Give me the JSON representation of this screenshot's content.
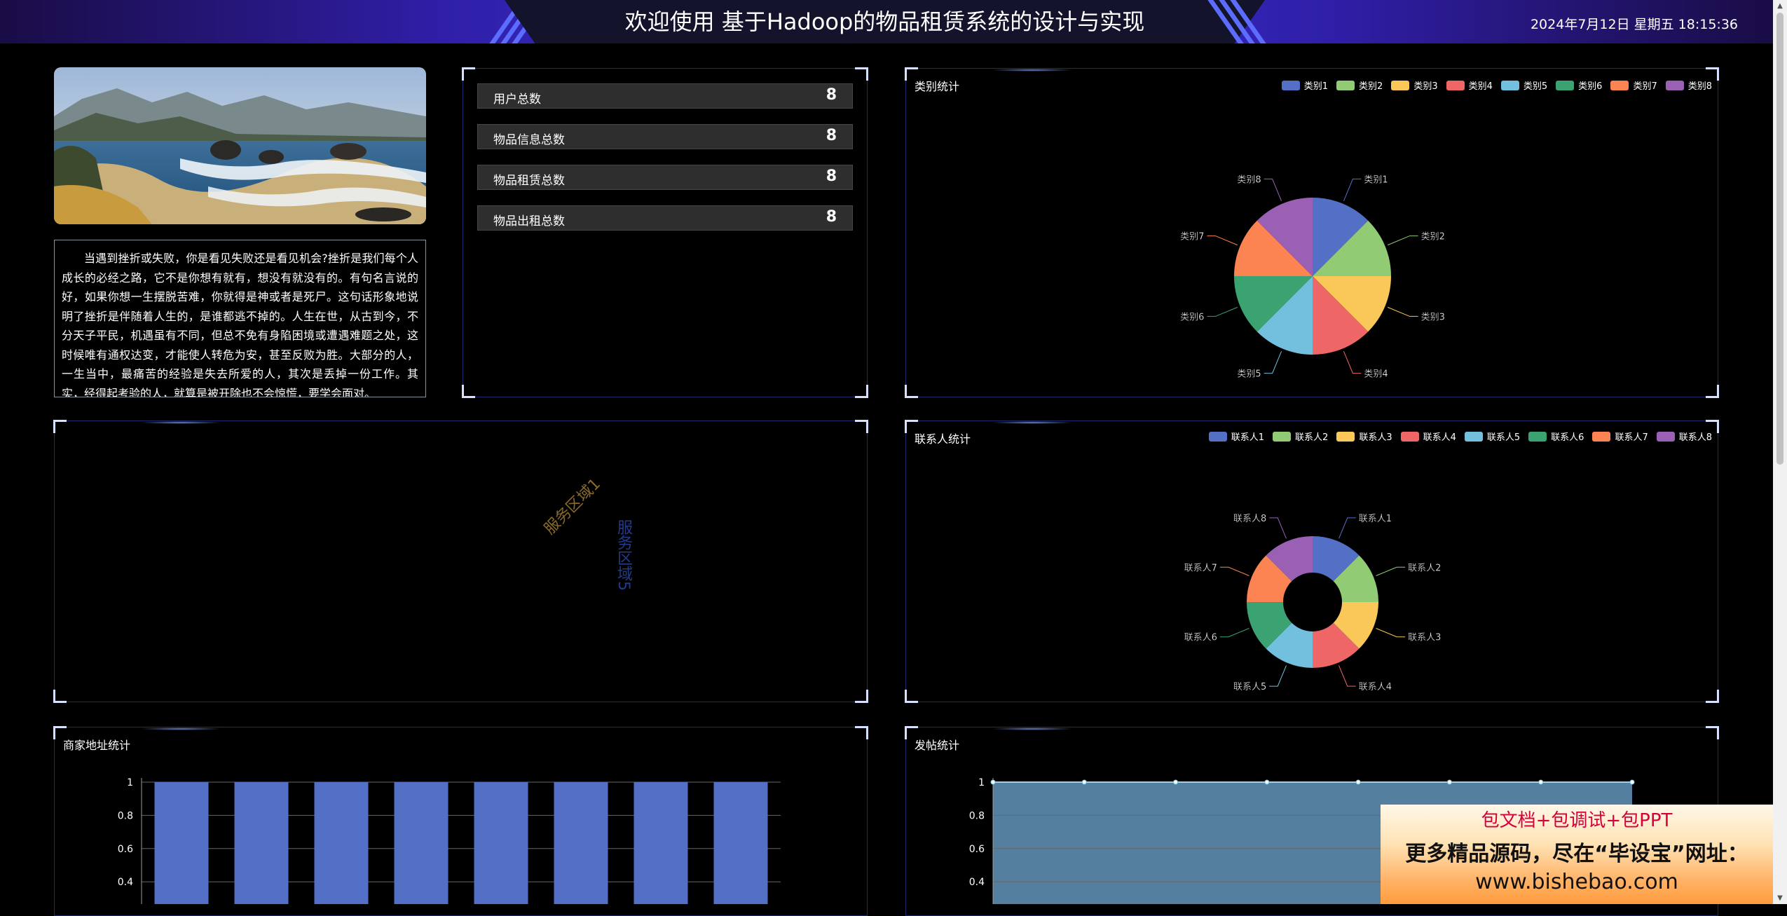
{
  "header": {
    "title": "欢迎使用 基于Hadoop的物品租赁系统的设计与实现",
    "datetime": "2024年7月12日 星期五 18:15:36"
  },
  "article": {
    "text": "当遇到挫折或失败，你是看见失败还是看见机会?挫折是我们每个人成长的必经之路，它不是你想有就有，想没有就没有的。有句名言说的好，如果你想一生摆脱苦难，你就得是神或者是死尸。这句话形象地说明了挫折是伴随着人生的，是谁都逃不掉的。人生在世，从古到今，不分天子平民，机遇虽有不同，但总不免有身陷困境或遭遇难题之处，这时候唯有通权达变，才能使人转危为安，甚至反败为胜。大部分的人，一生当中，最痛苦的经验是失去所爱的人，其次是丢掉一份工作。其实，经得起考验的人，就算是被开除也不会惊慌，要学会面对。"
  },
  "stats": [
    {
      "label": "用户总数",
      "value": "8"
    },
    {
      "label": "物品信息总数",
      "value": "8"
    },
    {
      "label": "物品租赁总数",
      "value": "8"
    },
    {
      "label": "物品出租总数",
      "value": "8"
    }
  ],
  "colors": {
    "palette": [
      "#5470c6",
      "#91cc75",
      "#fac858",
      "#ee6666",
      "#73c0de",
      "#3ba272",
      "#fc8452",
      "#9a60b4"
    ],
    "panel_border": "#1d2b6a",
    "header_accent": "#3a33d6"
  },
  "icons": {
    "scroll_up": "▲",
    "scroll_down": "▼"
  },
  "region_panel": {
    "labels": [
      "服务区域1",
      "服务区域5"
    ]
  },
  "chart_data": [
    {
      "id": "category",
      "type": "pie",
      "title": "类别统计",
      "categories": [
        "类别1",
        "类别2",
        "类别3",
        "类别4",
        "类别5",
        "类别6",
        "类别7",
        "类别8"
      ],
      "values": [
        1,
        1,
        1,
        1,
        1,
        1,
        1,
        1
      ],
      "legend": "top-right"
    },
    {
      "id": "contact",
      "type": "pie",
      "title": "联系人统计",
      "categories": [
        "联系人1",
        "联系人2",
        "联系人3",
        "联系人4",
        "联系人5",
        "联系人6",
        "联系人7",
        "联系人8"
      ],
      "values": [
        1,
        1,
        1,
        1,
        1,
        1,
        1,
        1
      ],
      "donut": true,
      "legend": "top-right"
    },
    {
      "id": "merchant",
      "type": "bar",
      "title": "商家地址统计",
      "categories": [
        "",
        "",
        "",
        "",
        "",
        "",
        "",
        ""
      ],
      "values": [
        1,
        1,
        1,
        1,
        1,
        1,
        1,
        1
      ],
      "yticks": [
        "1",
        "0.8",
        "0.6",
        "0.4"
      ],
      "ylim": [
        0,
        1
      ],
      "grid": true
    },
    {
      "id": "posts",
      "type": "area",
      "title": "发帖统计",
      "categories": [
        "",
        "",
        "",
        "",
        "",
        "",
        "",
        ""
      ],
      "values": [
        1,
        1,
        1,
        1,
        1,
        1,
        1,
        1
      ],
      "yticks": [
        "1",
        "0.8",
        "0.6",
        "0.4"
      ],
      "ylim": [
        0,
        1
      ],
      "grid": true
    }
  ],
  "ad": {
    "line1": "包文档+包调试+包PPT",
    "line2": "更多精品源码，尽在“毕设宝”网址：",
    "line3": "www.bishebao.com"
  }
}
